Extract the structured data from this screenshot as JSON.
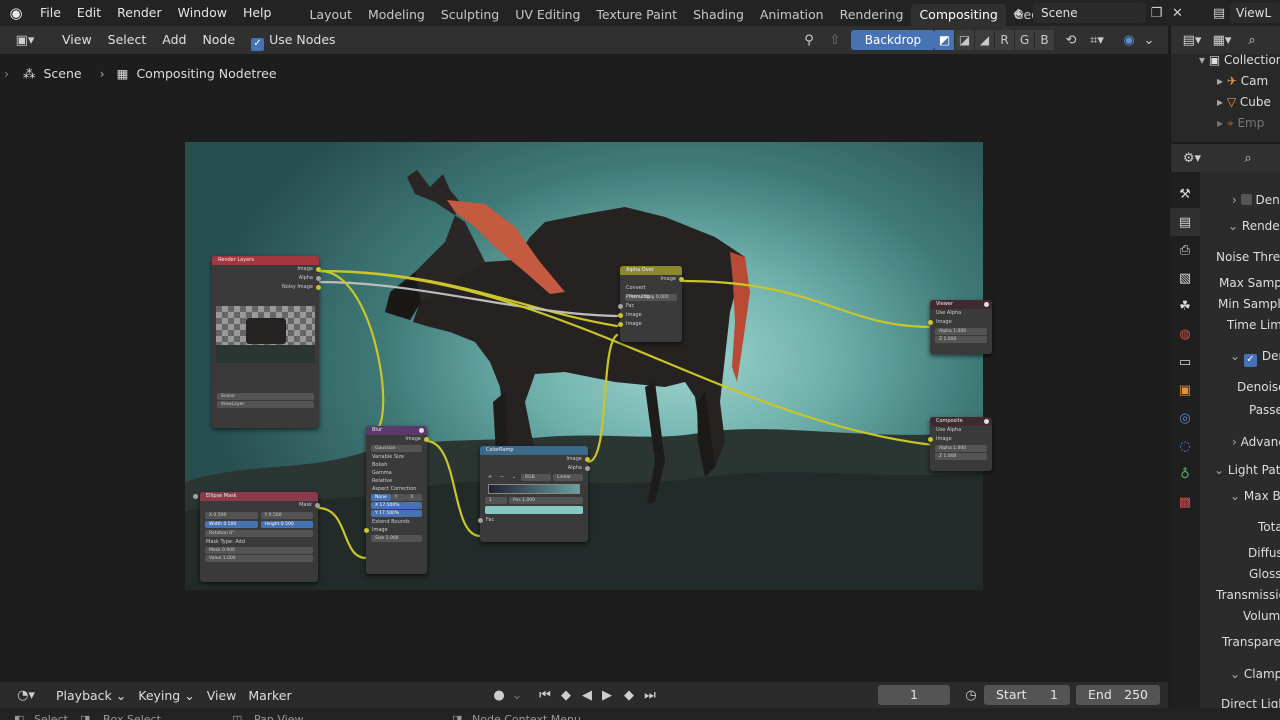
{
  "topbar": {
    "menus": [
      "File",
      "Edit",
      "Render",
      "Window",
      "Help"
    ],
    "workspaces": [
      "Layout",
      "Modeling",
      "Sculpting",
      "UV Editing",
      "Texture Paint",
      "Shading",
      "Animation",
      "Rendering",
      "Compositing",
      "Geometry Nod"
    ],
    "active_workspace": "Compositing",
    "scene_name": "Scene",
    "view_layer": "ViewL"
  },
  "editor_header": {
    "view": "View",
    "select": "Select",
    "add": "Add",
    "node": "Node",
    "use_nodes": "Use Nodes",
    "backdrop": "Backdrop",
    "channels": [
      "R",
      "G",
      "B"
    ]
  },
  "breadcrumb": {
    "scene": "Scene",
    "tree": "Compositing Nodetree"
  },
  "nodes": {
    "render_layers": {
      "title": "Render Layers",
      "outputs": [
        "Image",
        "Alpha",
        "Noisy Image"
      ],
      "scene": "Scene",
      "layer": "ViewLayer"
    },
    "alpha_over": {
      "title": "Alpha Over",
      "output": "Image",
      "convert": "Convert Premultip...",
      "premul": "Premultiply  0.000",
      "inputs": [
        "Fac",
        "Image",
        "Image"
      ]
    },
    "viewer": {
      "title": "Viewer",
      "use_alpha": "Use Alpha",
      "inputs": [
        "Image",
        "Alpha  1.000",
        "Z  1.000"
      ]
    },
    "composite": {
      "title": "Composite",
      "use_alpha": "Use Alpha",
      "inputs": [
        "Image",
        "Alpha  1.000",
        "Z  1.000"
      ]
    },
    "blur": {
      "title": "Blur",
      "output": "Image",
      "filter": "Gaussian",
      "options": [
        "Variable Size",
        "Bokeh",
        "Gamma",
        "Relative"
      ],
      "aspect": "Aspect Correction",
      "aspect_modes": [
        "None",
        "Y",
        "X"
      ],
      "x": "X  17.500%",
      "y": "Y  17.500%",
      "extend": "Extend Bounds",
      "image_in": "Image",
      "size": "Size  1.000"
    },
    "color_ramp": {
      "title": "ColorRamp",
      "outputs": [
        "Image",
        "Alpha"
      ],
      "mode": "RGB",
      "interp": "Linear",
      "pos_index": "1",
      "pos": "Pos  1.000",
      "fac": "Fac"
    },
    "ellipse_mask": {
      "title": "Ellipse Mask",
      "output": "Mask",
      "x": "X  0.500",
      "y": "Y  0.500",
      "width": "Width  0.500",
      "height": "Height  0.500",
      "rotation": "Rotation  0°",
      "mask_type": "Mask Type:  Add",
      "mask": "Mask  0.000",
      "value": "Value  1.000"
    }
  },
  "outliner": {
    "rows": [
      "Collection",
      "Cam",
      "Cube",
      "Emp"
    ]
  },
  "properties": {
    "rows": [
      "Den",
      "Render",
      "Noise Thres...",
      "Max Sampl...",
      "Min Samples",
      "Time Limit",
      "Den",
      "Denoise",
      "Passes",
      "Advanc",
      "Light Path",
      "Max Bo",
      "Tota",
      "Diffuse",
      "Glossy",
      "Transmission",
      "Volume",
      "Transparen",
      "Clamping",
      "Direct Light"
    ]
  },
  "timeline": {
    "playback": "Playback",
    "keying": "Keying",
    "view": "View",
    "marker": "Marker",
    "current_frame": "1",
    "start_label": "Start",
    "start": "1",
    "end_label": "End",
    "end": "250"
  },
  "statusbar": {
    "select": "Select",
    "box_select": "Box Select",
    "pan_view": "Pan View",
    "context_menu": "Node Context Menu"
  }
}
